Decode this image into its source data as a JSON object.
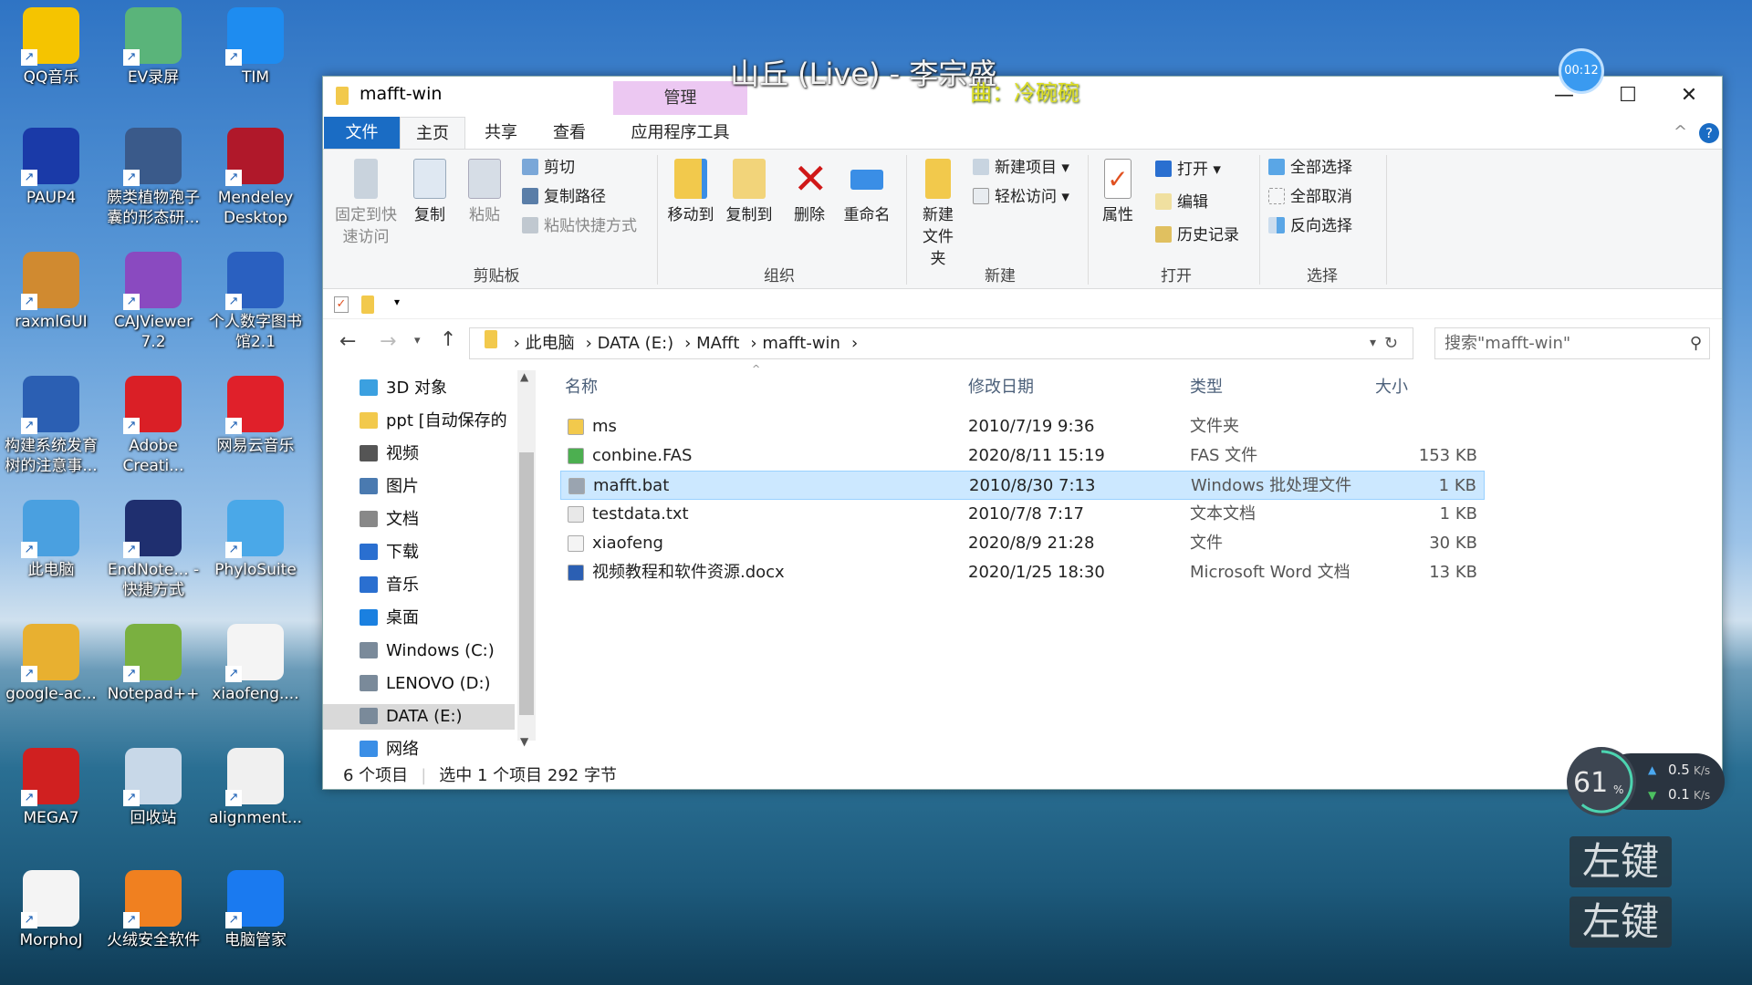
{
  "desktop": {
    "icons": [
      {
        "label": "QQ音乐",
        "color": "#f5c400"
      },
      {
        "label": "EV录屏",
        "color": "#5ab47a"
      },
      {
        "label": "TIM",
        "color": "#1e8cf0"
      },
      {
        "label": "PAUP4",
        "color": "#1a3aa8"
      },
      {
        "label": "蕨类植物孢子囊的形态研...",
        "color": "#3a5a8a"
      },
      {
        "label": "Mendeley Desktop",
        "color": "#b0182a"
      },
      {
        "label": "raxmlGUI",
        "color": "#d08a30"
      },
      {
        "label": "CAJViewer 7.2",
        "color": "#8a4ac0"
      },
      {
        "label": "个人数字图书馆2.1",
        "color": "#2a60c0"
      },
      {
        "label": "构建系统发育树的注意事...",
        "color": "#2b5fb3"
      },
      {
        "label": "Adobe Creati...",
        "color": "#da1f26"
      },
      {
        "label": "网易云音乐",
        "color": "#e0202a"
      },
      {
        "label": "此电脑",
        "color": "#4aa0e0"
      },
      {
        "label": "EndNote... - 快捷方式",
        "color": "#1f2f6f"
      },
      {
        "label": "PhyloSuite",
        "color": "#4aa8e8"
      },
      {
        "label": "google-ac...",
        "color": "#e8b030"
      },
      {
        "label": "Notepad++",
        "color": "#7ab040"
      },
      {
        "label": "xiaofeng....",
        "color": "#f4f4f4"
      },
      {
        "label": "MEGA7",
        "color": "#d02020"
      },
      {
        "label": "回收站",
        "color": "#c8d8e8"
      },
      {
        "label": "alignment...",
        "color": "#f0f0f0"
      },
      {
        "label": "MorphoJ",
        "color": "#f4f4f4"
      },
      {
        "label": "火绒安全软件",
        "color": "#f08020"
      },
      {
        "label": "电脑管家",
        "color": "#1a7af0"
      }
    ]
  },
  "overlay": {
    "lyric": "山丘 (Live) - 李宗盛",
    "lyric_sub": "曲：冷碗碗",
    "timer": "00:12",
    "cpu": "61",
    "cpu_unit": "%",
    "up": "0.5",
    "down": "0.1",
    "rate_unit": "K/s",
    "key1": "左键",
    "key2": "左键"
  },
  "window": {
    "title": "mafft-win",
    "manage": "管理",
    "minimize": "—",
    "maximize": "☐",
    "close": "✕",
    "collapse": "^",
    "help": "?",
    "tabs": [
      "文件",
      "主页",
      "共享",
      "查看",
      "应用程序工具"
    ],
    "ribbon": {
      "clipboard": {
        "group": "剪贴板",
        "pin": "固定到快速访问",
        "copy": "复制",
        "paste": "粘贴",
        "cut": "剪切",
        "copy_path": "复制路径",
        "paste_shortcut": "粘贴快捷方式"
      },
      "organize": {
        "group": "组织",
        "move_to": "移动到",
        "copy_to": "复制到",
        "delete": "删除",
        "rename": "重命名"
      },
      "new": {
        "group": "新建",
        "new_folder": "新建文件夹",
        "new_item": "新建项目",
        "easy_access": "轻松访问"
      },
      "open": {
        "group": "打开",
        "properties": "属性",
        "open": "打开",
        "edit": "编辑",
        "history": "历史记录"
      },
      "select": {
        "group": "选择",
        "select_all": "全部选择",
        "select_none": "全部取消",
        "invert": "反向选择"
      }
    },
    "address": {
      "segments": [
        "此电脑",
        "DATA (E:)",
        "MAfft",
        "mafft-win"
      ]
    },
    "search_placeholder": "搜索\"mafft-win\"",
    "nav": [
      "3D 对象",
      "ppt [自动保存的",
      "视频",
      "图片",
      "文档",
      "下载",
      "音乐",
      "桌面",
      "Windows (C:)",
      "LENOVO (D:)",
      "DATA (E:)",
      "网络"
    ],
    "columns": {
      "name": "名称",
      "date": "修改日期",
      "type": "类型",
      "size": "大小"
    },
    "files": [
      {
        "name": "ms",
        "date": "2010/7/19 9:36",
        "type": "文件夹",
        "size": "",
        "icon": "#f2c94c"
      },
      {
        "name": "conbine.FAS",
        "date": "2020/8/11 15:19",
        "type": "FAS 文件",
        "size": "153 KB",
        "icon": "#4caf50"
      },
      {
        "name": "mafft.bat",
        "date": "2010/8/30 7:13",
        "type": "Windows 批处理文件",
        "size": "1 KB",
        "icon": "#9aa4b0"
      },
      {
        "name": "testdata.txt",
        "date": "2010/7/8 7:17",
        "type": "文本文档",
        "size": "1 KB",
        "icon": "#e8e8e8"
      },
      {
        "name": "xiaofeng",
        "date": "2020/8/9 21:28",
        "type": "文件",
        "size": "30 KB",
        "icon": "#f4f4f4"
      },
      {
        "name": "视频教程和软件资源.docx",
        "date": "2020/1/25 18:30",
        "type": "Microsoft Word 文档",
        "size": "13 KB",
        "icon": "#2b5fb3"
      }
    ],
    "status": {
      "count": "6 个项目",
      "selected": "选中 1 个项目  292 字节"
    }
  }
}
